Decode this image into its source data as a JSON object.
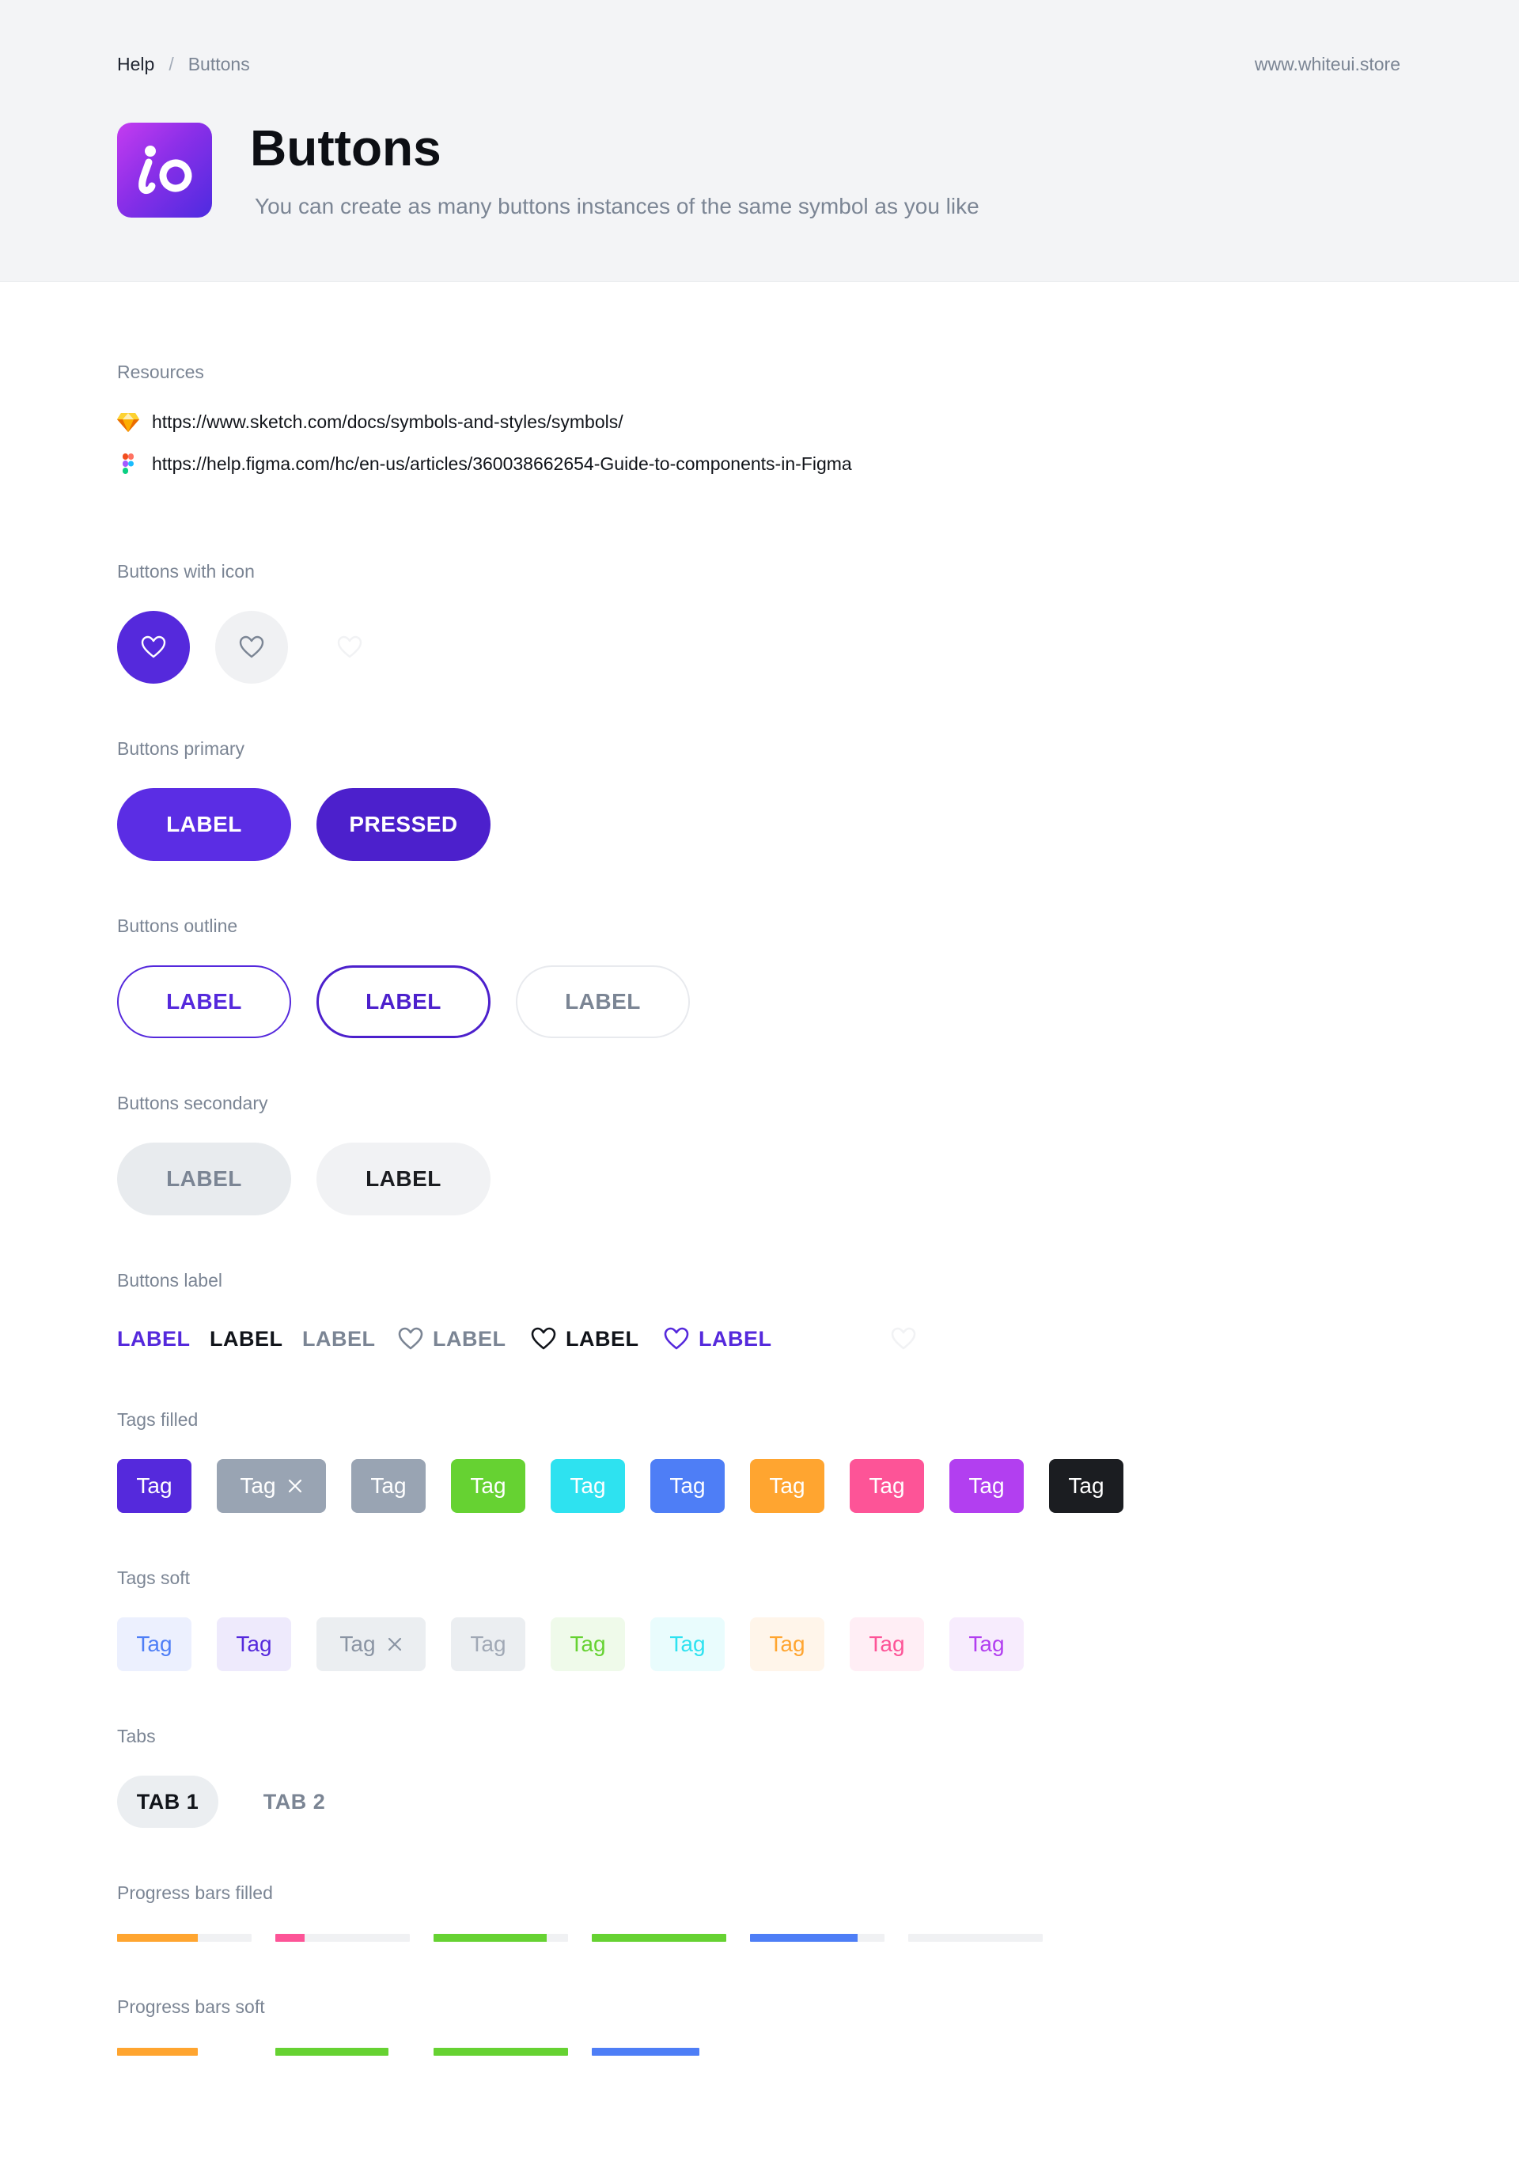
{
  "breadcrumb": {
    "home": "Help",
    "separator": "/",
    "current": "Buttons"
  },
  "site_link": "www.whiteui.store",
  "logo": {
    "text": "io"
  },
  "page": {
    "title": "Buttons",
    "subtitle": "You can create as many buttons instances of the same symbol as you like"
  },
  "sections": {
    "resources": "Resources",
    "buttons_with_icon": "Buttons with icon",
    "buttons_primary": "Buttons primary",
    "buttons_outline": "Buttons outline",
    "buttons_secondary": "Buttons secondary",
    "buttons_label": "Buttons label",
    "tags_filled": "Tags filled",
    "tags_soft": "Tags soft",
    "tabs": "Tabs",
    "progress_filled": "Progress bars filled",
    "progress_soft": "Progress bars soft"
  },
  "resources": [
    {
      "icon": "sketch-icon",
      "url": "https://www.sketch.com/docs/symbols-and-styles/symbols/"
    },
    {
      "icon": "figma-icon",
      "url": "https://help.figma.com/hc/en-us/articles/360038662654-Guide-to-components-in-Figma"
    }
  ],
  "icon_buttons": [
    {
      "icon": "heart-icon",
      "state": "primary"
    },
    {
      "icon": "heart-icon",
      "state": "secondary"
    },
    {
      "icon": "heart-icon",
      "state": "disabled"
    }
  ],
  "primary_buttons": [
    {
      "label": "LABEL",
      "state": "default"
    },
    {
      "label": "PRESSED",
      "state": "pressed"
    }
  ],
  "outline_buttons": [
    {
      "label": "LABEL",
      "state": "default"
    },
    {
      "label": "LABEL",
      "state": "pressed"
    },
    {
      "label": "LABEL",
      "state": "disabled"
    }
  ],
  "secondary_buttons": [
    {
      "label": "LABEL",
      "state": "default"
    },
    {
      "label": "LABEL",
      "state": "dark"
    }
  ],
  "label_buttons": [
    {
      "label": "LABEL",
      "color": "#5529dc",
      "icon": ""
    },
    {
      "label": "LABEL",
      "color": "#11141a",
      "icon": ""
    },
    {
      "label": "LABEL",
      "color": "#7b8594",
      "icon": ""
    },
    {
      "label": "LABEL",
      "color": "#7b8594",
      "icon": "heart-icon"
    },
    {
      "label": "LABEL",
      "color": "#11141a",
      "icon": "heart-icon"
    },
    {
      "label": "LABEL",
      "color": "#5529dc",
      "icon": "heart-icon"
    }
  ],
  "tags_filled": [
    {
      "label": "Tag",
      "bg": "#5529dc",
      "fg": "#ffffff",
      "closable": false
    },
    {
      "label": "Tag",
      "bg": "#99a4b3",
      "fg": "#ffffff",
      "closable": true
    },
    {
      "label": "Tag",
      "bg": "#99a4b3",
      "fg": "#ffffff",
      "closable": false
    },
    {
      "label": "Tag",
      "bg": "#66d232",
      "fg": "#ffffff",
      "closable": false
    },
    {
      "label": "Tag",
      "bg": "#2ee2f0",
      "fg": "#ffffff",
      "closable": false
    },
    {
      "label": "Tag",
      "bg": "#4e7ef6",
      "fg": "#ffffff",
      "closable": false
    },
    {
      "label": "Tag",
      "bg": "#ffa530",
      "fg": "#ffffff",
      "closable": false
    },
    {
      "label": "Tag",
      "bg": "#fd5497",
      "fg": "#ffffff",
      "closable": false
    },
    {
      "label": "Tag",
      "bg": "#b23ff0",
      "fg": "#ffffff",
      "closable": false
    },
    {
      "label": "Tag",
      "bg": "#1b1d21",
      "fg": "#ffffff",
      "closable": false
    }
  ],
  "tags_soft": [
    {
      "label": "Tag",
      "bg": "#ecf0fe",
      "fg": "#4e7ef6",
      "closable": false
    },
    {
      "label": "Tag",
      "bg": "#eeeafc",
      "fg": "#5529dc",
      "closable": false
    },
    {
      "label": "Tag",
      "bg": "#ebeef1",
      "fg": "#8a94a3",
      "closable": true
    },
    {
      "label": "Tag",
      "bg": "#ebeef1",
      "fg": "#a0a8b5",
      "closable": false
    },
    {
      "label": "Tag",
      "bg": "#effaea",
      "fg": "#66d232",
      "closable": false
    },
    {
      "label": "Tag",
      "bg": "#e9fcfd",
      "fg": "#2ee2f0",
      "closable": false
    },
    {
      "label": "Tag",
      "bg": "#fff5ea",
      "fg": "#ffa530",
      "closable": false
    },
    {
      "label": "Tag",
      "bg": "#ffeef5",
      "fg": "#fd5497",
      "closable": false
    },
    {
      "label": "Tag",
      "bg": "#f7ecfd",
      "fg": "#b23ff0",
      "closable": false
    }
  ],
  "tabs": [
    {
      "label": "TAB 1",
      "active": true
    },
    {
      "label": "TAB 2",
      "active": false
    }
  ],
  "progress_filled": [
    {
      "color": "#ffa530",
      "progress": 0.6
    },
    {
      "color": "#fd5497",
      "progress": 0.22
    },
    {
      "color": "#66d232",
      "progress": 0.84
    },
    {
      "color": "#66d232",
      "progress": 1.0
    },
    {
      "color": "#4e7ef6",
      "progress": 0.8
    },
    {
      "color": "#f0f1f3",
      "progress": 0.0
    }
  ],
  "progress_soft": [
    {
      "color": "#ffa530",
      "progress": 0.6
    },
    {
      "color": "#66d232",
      "progress": 0.84
    },
    {
      "color": "#66d232",
      "progress": 1.0
    },
    {
      "color": "#4e7ef6",
      "progress": 0.8
    }
  ]
}
